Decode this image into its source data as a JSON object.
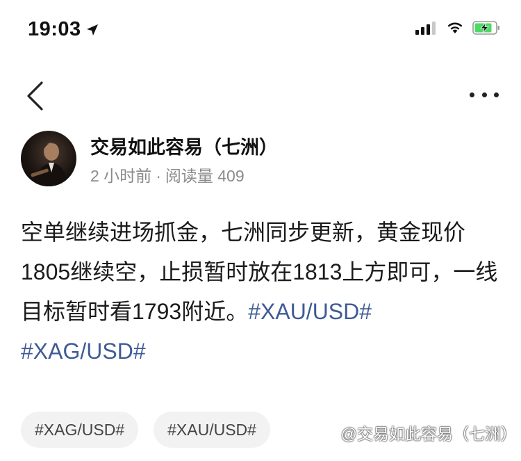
{
  "status_bar": {
    "time": "19:03",
    "icons": [
      "location-arrow-icon",
      "cellular-signal-icon",
      "wifi-icon",
      "battery-charging-icon"
    ]
  },
  "nav": {
    "back_icon": "chevron-left-icon",
    "more_icon": "more-horizontal-icon"
  },
  "author": {
    "name": "交易如此容易（七洲）",
    "time_ago": "2 小时前",
    "separator": "·",
    "reads": "阅读量 409"
  },
  "post": {
    "text": "空单继续进场抓金，七洲同步更新，黄金现价1805继续空，止损暂时放在1813上方即可，一线目标暂时看1793附近。",
    "hashtags": [
      "#XAU/USD#",
      "#XAG/USD#"
    ]
  },
  "tags": [
    "#XAG/USD#",
    "#XAU/USD#"
  ],
  "watermark": "@交易如此容易（七洲）",
  "colors": {
    "hashtag": "#3f5b95",
    "meta": "#8a8a8a",
    "chip_bg": "#f2f2f2",
    "battery_charge": "#4cd964"
  }
}
